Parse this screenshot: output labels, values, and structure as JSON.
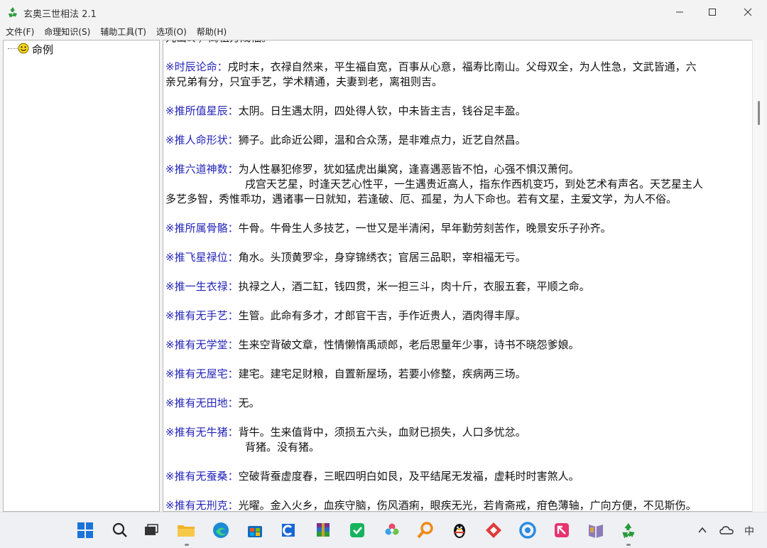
{
  "window": {
    "title": "玄奥三世相法 2.1",
    "icon": "recycle-icon",
    "controls": [
      "minimize-icon",
      "maximize-icon",
      "close-icon"
    ]
  },
  "menu": [
    "文件(F)",
    "命理知识(S)",
    "辅助工具(T)",
    "选项(O)",
    "帮助(H)"
  ],
  "tree": {
    "root_label": "命例",
    "root_icon": "smiley-icon"
  },
  "content": {
    "top_fragment": "九山岭，离祖方成福。",
    "sections": [
      {
        "head": "※时辰论命：",
        "lines": [
          "戌时末，衣禄自然来，平生福自宽，百事从心意，福寿比南山。父母双全，为人性急，文武皆通，六",
          "亲兄弟有分，只宜手艺，学术精通，夫妻到老，离祖则吉。"
        ]
      },
      {
        "head": "※推所值星辰：",
        "lines": [
          "太阴。日生遇太阴，四处得人钦，中未皆主吉，钱谷足丰盈。"
        ]
      },
      {
        "head": "※推人命形状：",
        "lines": [
          "狮子。此命近公卿，温和合众荡，是非难点力，近艺自然昌。"
        ]
      },
      {
        "head": "※推六道神数：",
        "lines": [
          "为人性暴犯修罗，犹如猛虎出巢窝，逢喜遇恶皆不怕，心强不惧汉萧何。"
        ],
        "sub": "戌宫天艺星，时逢天艺心性平，一生遇贵近高人，指东作西机变巧，到处艺术有声名。天艺星主人",
        "tail": "多艺多智，秀惟乖功，遇诸事一日就知，若逢破、厄、孤星，为人下命也。若有文星，主爱文学，为人不俗。"
      },
      {
        "head": "※推所属骨骼：",
        "lines": [
          "牛骨。牛骨生人多技艺，一世又是半清闲，早年勤劳刻苦作，晚景安乐子孙齐。"
        ]
      },
      {
        "head": "※推飞星禄位：",
        "lines": [
          "角水。头顶黄罗伞，身穿锦绣衣；官居三品职，宰相福无亏。"
        ]
      },
      {
        "head": "※推一生衣禄：",
        "lines": [
          "执禄之人，酒二缸，钱四贯，米一担三斗，肉十斤，衣服五套，平顺之命。"
        ]
      },
      {
        "head": "※推有无手艺：",
        "lines": [
          "生管。此命有多才，才郎官干吉，手作近贵人，酒肉得丰厚。"
        ]
      },
      {
        "head": "※推有无学堂：",
        "lines": [
          "生来空背破文章，性情懒惰禹顽郎，老后思量年少事，诗书不晓怨爹娘。"
        ]
      },
      {
        "head": "※推有无屋宅：",
        "lines": [
          "建宅。建宅足财粮，自置新屋场，若要小修整，疾病两三场。"
        ]
      },
      {
        "head": "※推有无田地：",
        "lines": [
          "无。"
        ]
      },
      {
        "head": "※推有无牛猪：",
        "lines": [
          "背牛。生来值背中，须损五六头，血财已损失，人口多忧忿。"
        ],
        "sub": "背猪。没有猪。"
      },
      {
        "head": "※推有无蚕桑：",
        "lines": [
          "空破背蚕虚度春，三眠四明白如艮，及平结尾无发福，虚耗时时害煞人。"
        ]
      },
      {
        "head": "※推有无刑克：",
        "lines": [
          "光曜。金入火乡，血疾守脑，伤风酒痢，眼疾无光，若肯斋戒，疳色薄轴，广向方便，不见斯伤。"
        ]
      }
    ]
  },
  "taskbar": {
    "apps": [
      "windows-start-icon",
      "search-icon",
      "task-view-icon",
      "file-explorer-icon",
      "edge-icon",
      "store-icon",
      "blue-c-app-icon",
      "winrar-icon",
      "green-app-icon",
      "flower-app-icon",
      "magnifier-app-icon",
      "qq-penguin-icon",
      "red-diamond-app-icon",
      "blue-circle-app-icon",
      "pink-app-icon",
      "ebook-app-icon",
      "recycle-app-icon"
    ],
    "tray": {
      "chevron": "chevron-up-icon",
      "cloud": "cloud-icon",
      "ime": "中"
    }
  }
}
